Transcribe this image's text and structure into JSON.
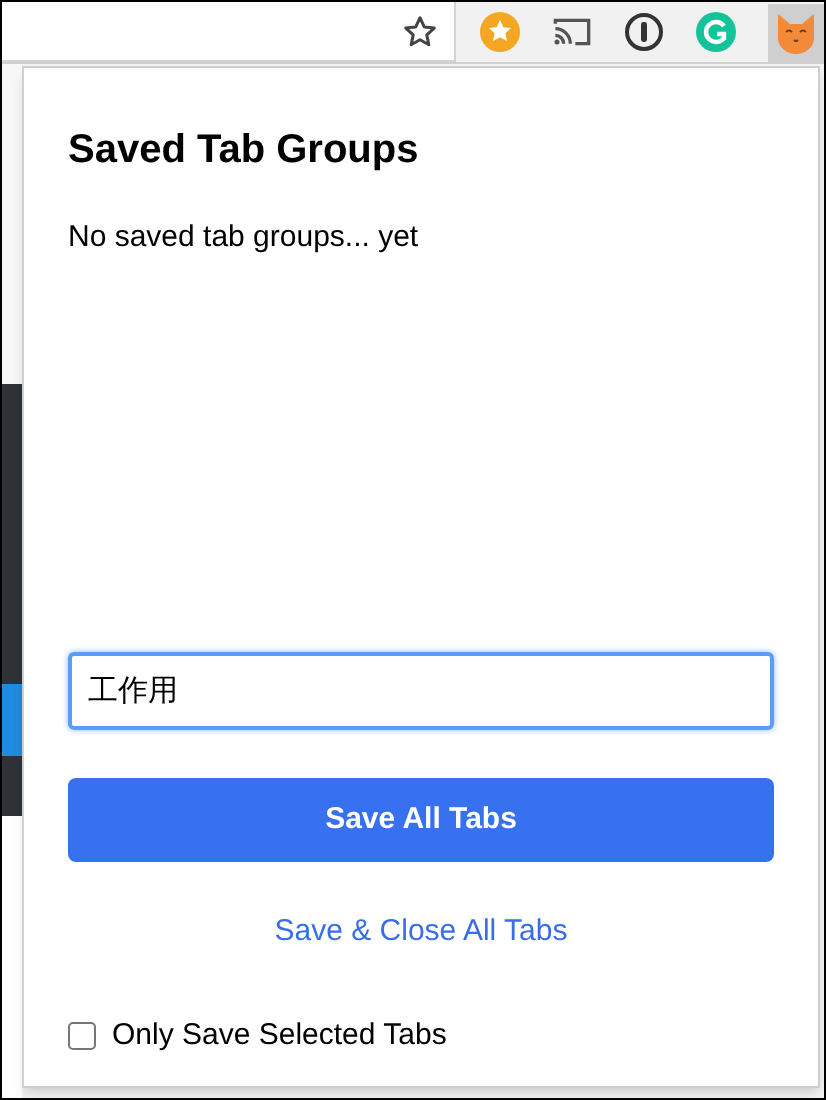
{
  "popup": {
    "title": "Saved Tab Groups",
    "message": "No saved tab groups... yet",
    "name_field": {
      "value": "工作用"
    },
    "primary_button": "Save All Tabs",
    "secondary_link": "Save & Close All Tabs",
    "option": {
      "label": "Only Save Selected Tabs",
      "checked": false
    }
  }
}
